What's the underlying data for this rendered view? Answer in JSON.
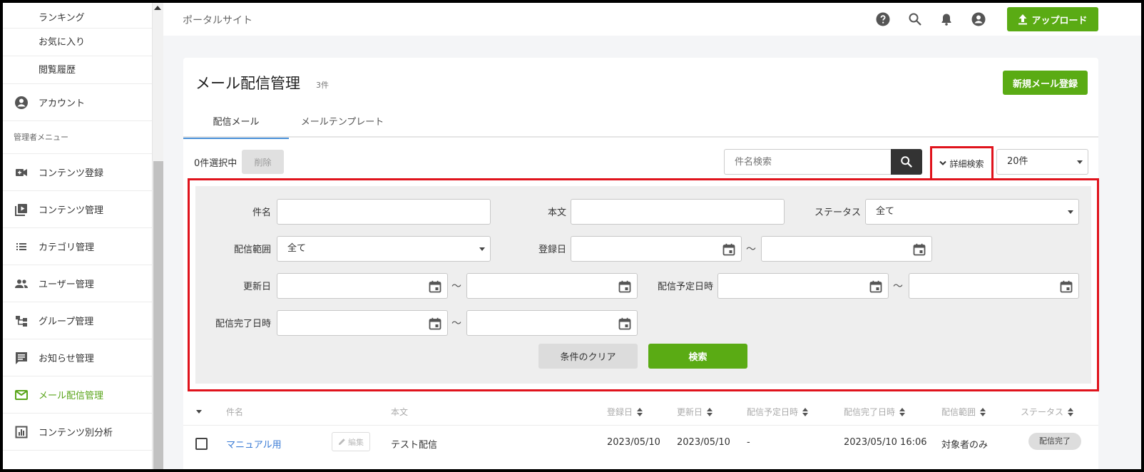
{
  "sidebar": {
    "sub_items": [
      "ランキング",
      "お気に入り",
      "閲覧履歴"
    ],
    "account": "アカウント",
    "admin_section": "管理者メニュー",
    "menu": [
      {
        "label": "コンテンツ登録",
        "icon": "video-add-icon"
      },
      {
        "label": "コンテンツ管理",
        "icon": "playlist-icon"
      },
      {
        "label": "カテゴリ管理",
        "icon": "list-icon"
      },
      {
        "label": "ユーザー管理",
        "icon": "people-icon"
      },
      {
        "label": "グループ管理",
        "icon": "tree-icon"
      },
      {
        "label": "お知らせ管理",
        "icon": "announcement-icon"
      },
      {
        "label": "メール配信管理",
        "icon": "mail-icon",
        "active": true
      },
      {
        "label": "コンテンツ別分析",
        "icon": "chart-icon"
      }
    ]
  },
  "header": {
    "site_title": "ポータルサイト",
    "upload_label": "アップロード",
    "icons": [
      "help-icon",
      "search-icon",
      "bell-icon",
      "account-icon"
    ]
  },
  "page": {
    "title": "メール配信管理",
    "count": "3件",
    "new_button": "新規メール登録",
    "tabs": [
      "配信メール",
      "メールテンプレート"
    ],
    "selected": "0件選択中",
    "delete_label": "削除",
    "search_placeholder": "件名検索",
    "advanced_label": "詳細検索",
    "per_page": "20件"
  },
  "filters": {
    "subject_label": "件名",
    "body_label": "本文",
    "status_label": "ステータス",
    "status_value": "全て",
    "scope_label": "配信範囲",
    "scope_value": "全て",
    "registered_label": "登録日",
    "updated_label": "更新日",
    "scheduled_label": "配信予定日時",
    "completed_label": "配信完了日時",
    "tilde": "～",
    "clear_label": "条件のクリア",
    "search_label": "検索"
  },
  "table": {
    "headers": {
      "subject": "件名",
      "body": "本文",
      "registered": "登録日",
      "updated": "更新日",
      "scheduled": "配信予定日時",
      "completed": "配信完了日時",
      "scope": "配信範囲",
      "status": "ステータス"
    },
    "rows": [
      {
        "subject": "マニュアル用",
        "edit": "編集",
        "body": "テスト配信",
        "registered": "2023/05/10",
        "updated": "2023/05/10",
        "scheduled": "-",
        "completed": "2023/05/10 16:06",
        "scope": "対象者のみ",
        "status": "配信完了"
      }
    ]
  },
  "colors": {
    "accent_green": "#5aab14",
    "highlight_red": "#e0131c",
    "link_blue": "#3a7bd5"
  }
}
